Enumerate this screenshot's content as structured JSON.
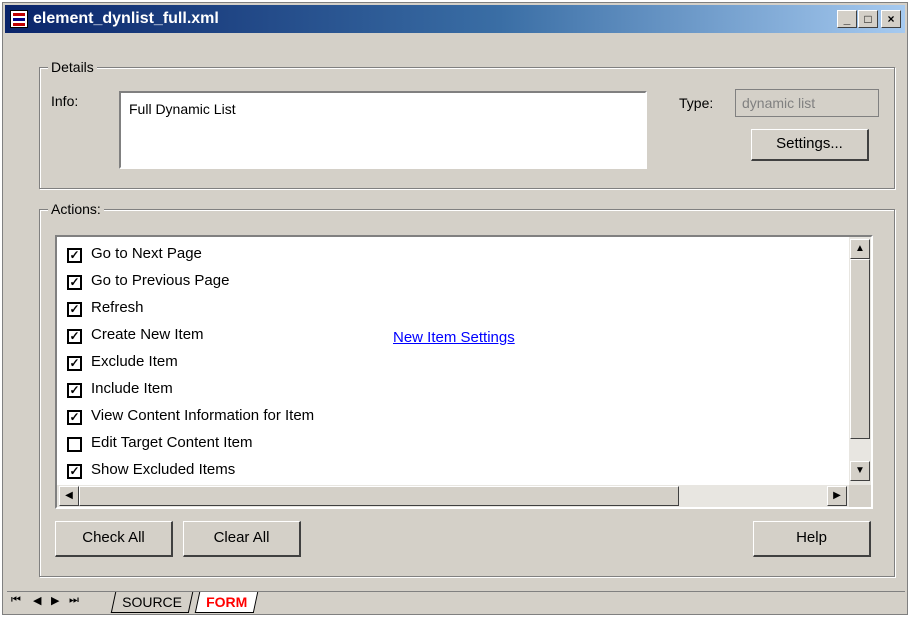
{
  "window": {
    "title": "element_dynlist_full.xml",
    "minimize_glyph": "_",
    "maximize_glyph": "□",
    "close_glyph": "×"
  },
  "details": {
    "group_label": "Details",
    "info_label": "Info:",
    "info_value": "Full Dynamic List",
    "type_label": "Type:",
    "type_value": "dynamic list",
    "settings_button": "Settings..."
  },
  "actions": {
    "group_label": "Actions:",
    "items": [
      {
        "label": "Go to Next Page",
        "checked": true
      },
      {
        "label": "Go to Previous Page",
        "checked": true
      },
      {
        "label": "Refresh",
        "checked": true
      },
      {
        "label": "Create New Item",
        "checked": true
      },
      {
        "label": "Exclude Item",
        "checked": true
      },
      {
        "label": "Include Item",
        "checked": true
      },
      {
        "label": "View Content Information for Item",
        "checked": true
      },
      {
        "label": "Edit Target Content Item",
        "checked": false
      },
      {
        "label": "Show Excluded Items",
        "checked": true
      }
    ],
    "link_text": "New Item Settings",
    "check_all_button": "Check All",
    "clear_all_button": "Clear All",
    "help_button": "Help"
  },
  "tabs": {
    "nav_first": "⏮",
    "nav_prev": "◀",
    "nav_next": "▶",
    "nav_last": "⏭",
    "items": [
      "SOURCE",
      "FORM"
    ],
    "active": "FORM"
  },
  "colors": {
    "title_bar": "#0a246a",
    "face": "#d4d0c8",
    "active_tab_text": "#ff0000",
    "link": "#0000ff"
  }
}
